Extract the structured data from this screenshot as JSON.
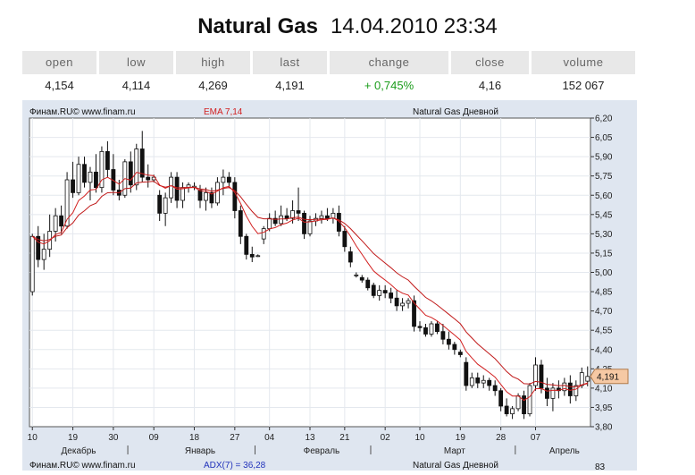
{
  "header": {
    "instrument": "Natural Gas",
    "datetime": "14.04.2010 23:34"
  },
  "quote": {
    "columns": [
      "open",
      "low",
      "high",
      "last",
      "change",
      "close",
      "volume"
    ],
    "values": [
      "4,154",
      "4,114",
      "4,269",
      "4,191",
      "+ 0,745%",
      "4,16",
      "152 067"
    ]
  },
  "chart_header": {
    "source": "Финам.RU© www.finam.ru",
    "indicator": "EMA 7,14",
    "name": "Natural Gas Дневной",
    "last_price_tag": "4,191"
  },
  "footer_panel": {
    "source": "Финам.RU© www.finam.ru",
    "indicator": "ADX(7) = 36,28",
    "name": "Natural Gas Дневной",
    "axis_label": "83"
  },
  "colors": {
    "ema_fast": "#d22020",
    "ema_slow": "#c01818",
    "positive": "#1a9c1a",
    "price_tag": "#f6c9a4"
  },
  "chart_data": {
    "type": "candlestick",
    "y_ticks": [
      "6,20",
      "6,05",
      "5,90",
      "5,75",
      "5,60",
      "5,45",
      "5,30",
      "5,15",
      "5,00",
      "4,85",
      "4,70",
      "4,55",
      "4,40",
      "4,25",
      "4,10",
      "3,95",
      "3,80"
    ],
    "ylim": [
      3.8,
      6.2
    ],
    "x_day_ticks": [
      {
        "label": "10",
        "i": 0
      },
      {
        "label": "19",
        "i": 7
      },
      {
        "label": "30",
        "i": 14
      },
      {
        "label": "09",
        "i": 21
      },
      {
        "label": "18",
        "i": 28
      },
      {
        "label": "27",
        "i": 35
      },
      {
        "label": "04",
        "i": 41
      },
      {
        "label": "13",
        "i": 48
      },
      {
        "label": "21",
        "i": 54
      },
      {
        "label": "02",
        "i": 61
      },
      {
        "label": "10",
        "i": 67
      },
      {
        "label": "19",
        "i": 74
      },
      {
        "label": "28",
        "i": 81
      },
      {
        "label": "07",
        "i": 87
      }
    ],
    "x_months": [
      {
        "label": "Декабрь",
        "i": 8
      },
      {
        "label": "Январь",
        "i": 29
      },
      {
        "label": "Февраль",
        "i": 50
      },
      {
        "label": "Март",
        "i": 73
      },
      {
        "label": "Апрель",
        "i": 92
      }
    ],
    "month_separators": [
      17,
      39,
      59,
      84
    ],
    "series": [
      {
        "name": "Natural Gas Дневной",
        "candles": [
          {
            "o": 4.85,
            "h": 5.3,
            "l": 4.82,
            "c": 5.28
          },
          {
            "o": 5.28,
            "h": 5.36,
            "l": 5.04,
            "c": 5.1
          },
          {
            "o": 5.1,
            "h": 5.3,
            "l": 5.02,
            "c": 5.18
          },
          {
            "o": 5.18,
            "h": 5.45,
            "l": 5.12,
            "c": 5.32
          },
          {
            "o": 5.32,
            "h": 5.5,
            "l": 5.24,
            "c": 5.44
          },
          {
            "o": 5.44,
            "h": 5.52,
            "l": 5.3,
            "c": 5.36
          },
          {
            "o": 5.36,
            "h": 5.78,
            "l": 5.34,
            "c": 5.72
          },
          {
            "o": 5.72,
            "h": 5.86,
            "l": 5.58,
            "c": 5.62
          },
          {
            "o": 5.62,
            "h": 5.9,
            "l": 5.6,
            "c": 5.84
          },
          {
            "o": 5.84,
            "h": 5.9,
            "l": 5.66,
            "c": 5.7
          },
          {
            "o": 5.7,
            "h": 5.82,
            "l": 5.56,
            "c": 5.78
          },
          {
            "o": 5.78,
            "h": 5.92,
            "l": 5.62,
            "c": 5.66
          },
          {
            "o": 5.66,
            "h": 5.98,
            "l": 5.62,
            "c": 5.94
          },
          {
            "o": 5.94,
            "h": 6.02,
            "l": 5.74,
            "c": 5.8
          },
          {
            "o": 5.8,
            "h": 5.92,
            "l": 5.6,
            "c": 5.64
          },
          {
            "o": 5.64,
            "h": 5.72,
            "l": 5.56,
            "c": 5.6
          },
          {
            "o": 5.6,
            "h": 5.88,
            "l": 5.58,
            "c": 5.86
          },
          {
            "o": 5.86,
            "h": 5.94,
            "l": 5.62,
            "c": 5.68
          },
          {
            "o": 5.68,
            "h": 6.0,
            "l": 5.64,
            "c": 5.96
          },
          {
            "o": 5.96,
            "h": 6.1,
            "l": 5.7,
            "c": 5.74
          },
          {
            "o": 5.74,
            "h": 5.84,
            "l": 5.66,
            "c": 5.72
          },
          {
            "o": 5.72,
            "h": 5.76,
            "l": 5.7,
            "c": 5.74
          },
          {
            "o": 5.6,
            "h": 5.64,
            "l": 5.4,
            "c": 5.46
          },
          {
            "o": 5.46,
            "h": 5.62,
            "l": 5.36,
            "c": 5.58
          },
          {
            "o": 5.58,
            "h": 5.78,
            "l": 5.54,
            "c": 5.74
          },
          {
            "o": 5.74,
            "h": 5.78,
            "l": 5.5,
            "c": 5.56
          },
          {
            "o": 5.56,
            "h": 5.7,
            "l": 5.5,
            "c": 5.66
          },
          {
            "o": 5.66,
            "h": 5.7,
            "l": 5.62,
            "c": 5.68
          },
          {
            "o": 5.66,
            "h": 5.7,
            "l": 5.64,
            "c": 5.67
          },
          {
            "o": 5.64,
            "h": 5.68,
            "l": 5.5,
            "c": 5.56
          },
          {
            "o": 5.56,
            "h": 5.66,
            "l": 5.48,
            "c": 5.62
          },
          {
            "o": 5.62,
            "h": 5.66,
            "l": 5.5,
            "c": 5.54
          },
          {
            "o": 5.54,
            "h": 5.74,
            "l": 5.52,
            "c": 5.7
          },
          {
            "o": 5.7,
            "h": 5.8,
            "l": 5.6,
            "c": 5.74
          },
          {
            "o": 5.74,
            "h": 5.78,
            "l": 5.66,
            "c": 5.7
          },
          {
            "o": 5.7,
            "h": 5.74,
            "l": 5.42,
            "c": 5.48
          },
          {
            "o": 5.48,
            "h": 5.52,
            "l": 5.22,
            "c": 5.28
          },
          {
            "o": 5.28,
            "h": 5.3,
            "l": 5.1,
            "c": 5.14
          },
          {
            "o": 5.14,
            "h": 5.2,
            "l": 5.08,
            "c": 5.12
          },
          {
            "o": 5.13,
            "h": 5.14,
            "l": 5.12,
            "c": 5.13
          },
          {
            "o": 5.26,
            "h": 5.36,
            "l": 5.22,
            "c": 5.34
          },
          {
            "o": 5.34,
            "h": 5.46,
            "l": 5.32,
            "c": 5.42
          },
          {
            "o": 5.42,
            "h": 5.48,
            "l": 5.36,
            "c": 5.38
          },
          {
            "o": 5.38,
            "h": 5.52,
            "l": 5.36,
            "c": 5.44
          },
          {
            "o": 5.44,
            "h": 5.5,
            "l": 5.4,
            "c": 5.42
          },
          {
            "o": 5.42,
            "h": 5.56,
            "l": 5.38,
            "c": 5.48
          },
          {
            "o": 5.48,
            "h": 5.66,
            "l": 5.4,
            "c": 5.46
          },
          {
            "o": 5.46,
            "h": 5.48,
            "l": 5.26,
            "c": 5.3
          },
          {
            "o": 5.3,
            "h": 5.44,
            "l": 5.28,
            "c": 5.4
          },
          {
            "o": 5.4,
            "h": 5.46,
            "l": 5.36,
            "c": 5.42
          },
          {
            "o": 5.42,
            "h": 5.48,
            "l": 5.38,
            "c": 5.44
          },
          {
            "o": 5.44,
            "h": 5.5,
            "l": 5.4,
            "c": 5.42
          },
          {
            "o": 5.42,
            "h": 5.5,
            "l": 5.38,
            "c": 5.46
          },
          {
            "o": 5.46,
            "h": 5.52,
            "l": 5.28,
            "c": 5.32
          },
          {
            "o": 5.32,
            "h": 5.36,
            "l": 5.16,
            "c": 5.2
          },
          {
            "o": 5.16,
            "h": 5.2,
            "l": 5.04,
            "c": 5.08
          },
          {
            "o": 4.98,
            "h": 5.0,
            "l": 4.96,
            "c": 4.98
          },
          {
            "o": 4.96,
            "h": 4.98,
            "l": 4.92,
            "c": 4.94
          },
          {
            "o": 4.94,
            "h": 4.96,
            "l": 4.86,
            "c": 4.88
          },
          {
            "o": 4.9,
            "h": 4.92,
            "l": 4.8,
            "c": 4.82
          },
          {
            "o": 4.82,
            "h": 4.9,
            "l": 4.78,
            "c": 4.86
          },
          {
            "o": 4.86,
            "h": 4.9,
            "l": 4.8,
            "c": 4.84
          },
          {
            "o": 4.84,
            "h": 4.88,
            "l": 4.76,
            "c": 4.8
          },
          {
            "o": 4.8,
            "h": 4.86,
            "l": 4.7,
            "c": 4.74
          },
          {
            "o": 4.74,
            "h": 4.8,
            "l": 4.7,
            "c": 4.76
          },
          {
            "o": 4.76,
            "h": 4.8,
            "l": 4.72,
            "c": 4.78
          },
          {
            "o": 4.78,
            "h": 4.82,
            "l": 4.54,
            "c": 4.58
          },
          {
            "o": 4.58,
            "h": 4.62,
            "l": 4.54,
            "c": 4.57
          },
          {
            "o": 4.57,
            "h": 4.6,
            "l": 4.5,
            "c": 4.52
          },
          {
            "o": 4.52,
            "h": 4.62,
            "l": 4.5,
            "c": 4.6
          },
          {
            "o": 4.6,
            "h": 4.62,
            "l": 4.52,
            "c": 4.54
          },
          {
            "o": 4.54,
            "h": 4.6,
            "l": 4.44,
            "c": 4.48
          },
          {
            "o": 4.48,
            "h": 4.54,
            "l": 4.4,
            "c": 4.44
          },
          {
            "o": 4.44,
            "h": 4.46,
            "l": 4.36,
            "c": 4.4
          },
          {
            "o": 4.38,
            "h": 4.4,
            "l": 4.34,
            "c": 4.36
          },
          {
            "o": 4.3,
            "h": 4.34,
            "l": 4.08,
            "c": 4.12
          },
          {
            "o": 4.12,
            "h": 4.22,
            "l": 4.1,
            "c": 4.18
          },
          {
            "o": 4.18,
            "h": 4.22,
            "l": 4.1,
            "c": 4.14
          },
          {
            "o": 4.14,
            "h": 4.2,
            "l": 4.1,
            "c": 4.16
          },
          {
            "o": 4.16,
            "h": 4.18,
            "l": 4.08,
            "c": 4.12
          },
          {
            "o": 4.12,
            "h": 4.16,
            "l": 4.04,
            "c": 4.08
          },
          {
            "o": 4.08,
            "h": 4.1,
            "l": 3.92,
            "c": 3.96
          },
          {
            "o": 3.96,
            "h": 4.02,
            "l": 3.88,
            "c": 3.9
          },
          {
            "o": 3.9,
            "h": 3.96,
            "l": 3.86,
            "c": 3.94
          },
          {
            "o": 3.94,
            "h": 4.06,
            "l": 3.92,
            "c": 4.04
          },
          {
            "o": 4.04,
            "h": 4.08,
            "l": 3.86,
            "c": 3.9
          },
          {
            "o": 3.9,
            "h": 4.14,
            "l": 3.88,
            "c": 4.12
          },
          {
            "o": 4.12,
            "h": 4.34,
            "l": 4.08,
            "c": 4.28
          },
          {
            "o": 4.28,
            "h": 4.32,
            "l": 4.06,
            "c": 4.1
          },
          {
            "o": 4.1,
            "h": 4.18,
            "l": 3.96,
            "c": 4.02
          },
          {
            "o": 4.02,
            "h": 4.14,
            "l": 3.92,
            "c": 4.1
          },
          {
            "o": 4.1,
            "h": 4.16,
            "l": 4.02,
            "c": 4.08
          },
          {
            "o": 4.08,
            "h": 4.18,
            "l": 4.04,
            "c": 4.14
          },
          {
            "o": 4.14,
            "h": 4.2,
            "l": 3.98,
            "c": 4.04
          },
          {
            "o": 4.04,
            "h": 4.16,
            "l": 4.0,
            "c": 4.12
          },
          {
            "o": 4.12,
            "h": 4.26,
            "l": 4.1,
            "c": 4.22
          },
          {
            "o": 4.154,
            "h": 4.269,
            "l": 4.114,
            "c": 4.191
          }
        ]
      }
    ]
  }
}
